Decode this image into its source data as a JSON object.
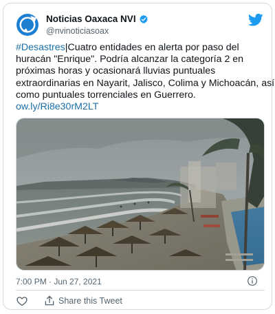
{
  "account": {
    "display_name": "Noticias Oaxaca NVI",
    "handle": "@nvinoticiasoax"
  },
  "tweet": {
    "hashtag": "#Desastres",
    "lines": [
      "|Cuatro entidades en alerta por paso del",
      "huracán \"Enrique\". Podría alcanzar la categoría 2 en",
      "próximas horas y ocasionará lluvias puntuales",
      "extraordinarias en Nayarit, Jalisco, Colima y Michoacán, así",
      "como puntuales torrenciales en Guerrero."
    ],
    "link": "ow.ly/Ri8e30rM2LT",
    "timestamp": "7:00 PM · Jun 27, 2021"
  },
  "actions": {
    "share_label": "Share this Tweet"
  },
  "colors": {
    "link": "#1b6fa8",
    "twitter_blue": "#1d9bf0",
    "secondary_text": "#536471",
    "border": "#cfd9de"
  },
  "icons": [
    "avatar-logo",
    "verified-badge-icon",
    "twitter-bird-icon",
    "info-icon",
    "like-heart-icon",
    "share-icon"
  ]
}
